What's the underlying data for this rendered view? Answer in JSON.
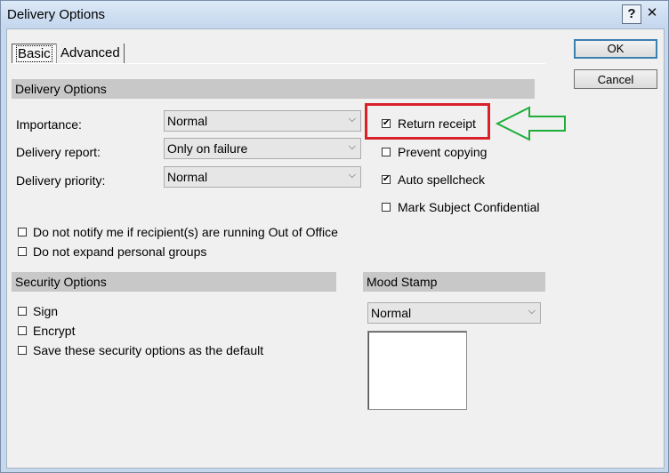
{
  "window": {
    "title": "Delivery Options",
    "help_glyph": "?",
    "close_glyph": "✕"
  },
  "tabs": [
    {
      "label": "Basic"
    },
    {
      "label": "Advanced"
    }
  ],
  "buttons": {
    "ok": "OK",
    "cancel": "Cancel"
  },
  "delivery": {
    "header": "Delivery Options",
    "importance": {
      "label": "Importance:",
      "value": "Normal"
    },
    "report": {
      "label": "Delivery report:",
      "value": "Only on failure"
    },
    "priority": {
      "label": "Delivery priority:",
      "value": "Normal"
    },
    "checks": [
      {
        "label": "Return receipt",
        "checked": true
      },
      {
        "label": "Prevent copying",
        "checked": false
      },
      {
        "label": "Auto spellcheck",
        "checked": true
      },
      {
        "label": "Mark Subject Confidential",
        "checked": false
      }
    ],
    "notify_ooo": "Do not notify me if recipient(s) are running Out of Office",
    "no_expand": "Do not expand personal groups"
  },
  "security": {
    "header": "Security Options",
    "sign": "Sign",
    "encrypt": "Encrypt",
    "save_default": "Save these security options as the default"
  },
  "mood": {
    "header": "Mood Stamp",
    "value": "Normal"
  },
  "glyphs": {
    "check": "✔",
    "chevron": "⌵"
  },
  "colors": {
    "highlight_red": "#d9212a",
    "arrow_green": "#1fae3a"
  }
}
